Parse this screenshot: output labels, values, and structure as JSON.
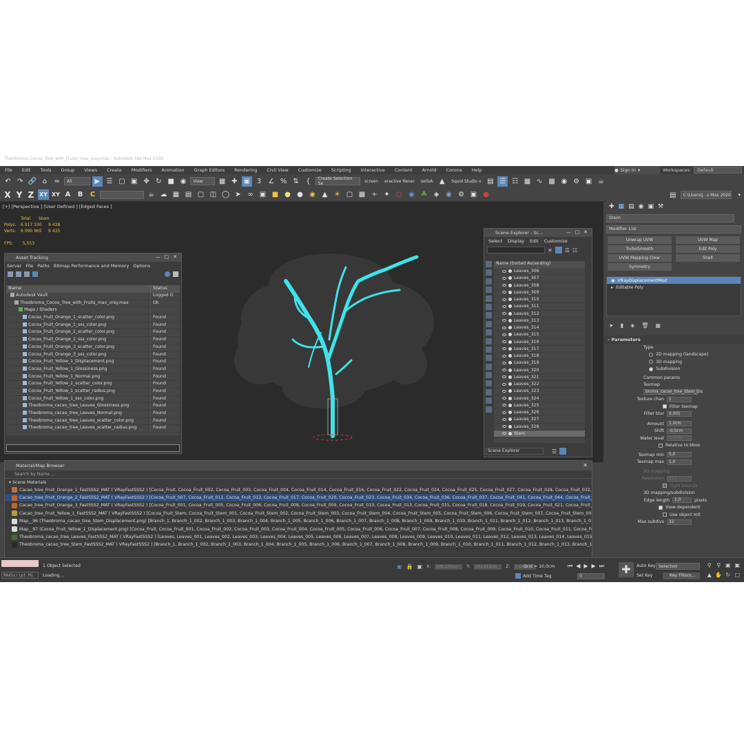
{
  "window": {
    "title": "Theobroma_Cocoa_Tree_with_Fruits_max_vray.max - Autodesk 3ds Max 2020"
  },
  "menubar": {
    "items": [
      "File",
      "Edit",
      "Tools",
      "Group",
      "Views",
      "Create",
      "Modifiers",
      "Animation",
      "Graph Editors",
      "Rendering",
      "Civil View",
      "Customize",
      "Scripting",
      "Interactive",
      "Content",
      "Arnold",
      "Corona",
      "Help"
    ]
  },
  "signin": {
    "label": "Sign In"
  },
  "workspaces": {
    "label": "Workspaces:",
    "value": "Default"
  },
  "toolbar": {
    "filter_value": "All",
    "view_value": "View",
    "selection_set": "Create Selection Se",
    "screen_label": "screen",
    "interactive_label": "eractive Rener",
    "sellsA_label": "sellsA",
    "squid_label": "Squid Studio v",
    "axis": [
      "X",
      "Y",
      "Z",
      "XY",
      "XY"
    ],
    "path": "C:\\Users\\J...s Max 2020"
  },
  "viewport": {
    "label": "[+] [Perspective ] [User Defined ] [Edged Faces ]",
    "stats": {
      "total_label": "Total",
      "stem_label": "Stem",
      "polys_label": "Polys:",
      "polys_total": "6 017 330",
      "polys_stem": "9 438",
      "verts_label": "Verts:",
      "verts_total": "6 090 965",
      "verts_stem": "9 435",
      "fps_label": "FPS:",
      "fps_value": "5,553"
    }
  },
  "asset_tracking": {
    "title": "Asset Tracking",
    "menu": [
      "Server",
      "File",
      "Paths",
      "Bitmap Performance and Memory",
      "Options"
    ],
    "columns": {
      "name": "Name",
      "status": "Status"
    },
    "rows": [
      {
        "name": "Autodesk Vault",
        "status": "Logged O",
        "indent": 1
      },
      {
        "name": "Theobroma_Cocoa_Tree_with_Fruits_max_vray.max",
        "status": "Ok",
        "indent": 2
      },
      {
        "name": "Maps / Shaders",
        "status": "",
        "indent": 3
      },
      {
        "name": "Cocoa_Fruit_Orange_1_scatter_color.png",
        "status": "Found",
        "indent": 4
      },
      {
        "name": "Cocoa_Fruit_Orange_1_sss_color.png",
        "status": "Found",
        "indent": 4
      },
      {
        "name": "Cocoa_Fruit_Orange_2_scatter_color.png",
        "status": "Found",
        "indent": 4
      },
      {
        "name": "Cocoa_Fruit_Orange_2_sss_color.png",
        "status": "Found",
        "indent": 4
      },
      {
        "name": "Cocoa_Fruit_Orange_3_scatter_color.png",
        "status": "Found",
        "indent": 4
      },
      {
        "name": "Cocoa_Fruit_Orange_3_sss_color.png",
        "status": "Found",
        "indent": 4
      },
      {
        "name": "Cocoa_Fruit_Yellow_1_Displacement.png",
        "status": "Found",
        "indent": 4
      },
      {
        "name": "Cocoa_Fruit_Yellow_1_Glossiness.png",
        "status": "Found",
        "indent": 4
      },
      {
        "name": "Cocoa_Fruit_Yellow_1_Normal.png",
        "status": "Found",
        "indent": 4
      },
      {
        "name": "Cocoa_Fruit_Yellow_1_scatter_color.png",
        "status": "Found",
        "indent": 4
      },
      {
        "name": "Cocoa_Fruit_Yellow_1_scatter_radius.png",
        "status": "Found",
        "indent": 4
      },
      {
        "name": "Cocoa_Fruit_Yellow_1_sss_color.png",
        "status": "Found",
        "indent": 4
      },
      {
        "name": "Theobroma_cacao_tree_Leaves_Glossiness.png",
        "status": "Found",
        "indent": 4
      },
      {
        "name": "Theobroma_cacao_tree_Leaves_Normal.png",
        "status": "Found",
        "indent": 4
      },
      {
        "name": "Theobroma_cacao_tree_Leaves_scatter_color.png",
        "status": "Found",
        "indent": 4
      },
      {
        "name": "Theobroma_cacao_tree_Leaves_scatter_radius.png",
        "status": "Found",
        "indent": 4
      }
    ]
  },
  "scene_explorer": {
    "title": "Scene Explorer - Sc...",
    "menu": [
      "Select",
      "Display",
      "Edit",
      "Customize"
    ],
    "column": "Name (Sorted Ascending)",
    "items": [
      "Leaves_306",
      "Leaves_307",
      "Leaves_308",
      "Leaves_309",
      "Leaves_310",
      "Leaves_311",
      "Leaves_312",
      "Leaves_313",
      "Leaves_314",
      "Leaves_315",
      "Leaves_316",
      "Leaves_317",
      "Leaves_318",
      "Leaves_319",
      "Leaves_320",
      "Leaves_321",
      "Leaves_322",
      "Leaves_323",
      "Leaves_324",
      "Leaves_325",
      "Leaves_326",
      "Leaves_327",
      "Leaves_328",
      "Stem"
    ],
    "footer": "Scene Explorer"
  },
  "material_browser": {
    "title": "Material/Map Browser",
    "search_placeholder": "Search by Name ...",
    "section": "Scene Materials",
    "rows": [
      {
        "text": "Cacao_tree_Fruit_Orange_1_FastSSS2_MAT  ( VRayFastSSS2 )  [Cocoa_Fruit, Cocoa_Fruit_002, Cocoa_Fruit_003, Cocoa_Fruit_004, Cocoa_Fruit_014, Cocoa_Fruit_016, Cocoa_Fruit_022, Cocoa_Fruit_024, Cocoa_Fruit_025, Cocoa_Fruit_027, Cocoa_Fruit_028, Cocoa_Fruit_032, Cocoa_Fru...",
        "color": "#c0703a"
      },
      {
        "text": "Cacao_tree_Fruit_Orange_2_FastSSS2_MAT  ( VRayFastSSS2 )  [Cocoa_Fruit_007, Cocoa_Fruit_011, Cocoa_Fruit_012, Cocoa_Fruit_017, Cocoa_Fruit_020, Cocoa_Fruit_023, Cocoa_Fruit_034, Cocoa_Fruit_036, Cocoa_Fruit_037, Cocoa_Fruit_041, Cocoa_Fruit_044, Cocoa_Fruit_045, Coco...",
        "color": "#c8602a"
      },
      {
        "text": "Cacao_tree_Fruit_Orange_3_FastSSS2_MAT  ( VRayFastSSS2 )  [Cocoa_Fruit_001, Cocoa_Fruit_005, Cocoa_Fruit_006, Cocoa_Fruit_008, Cocoa_Fruit_009, Cocoa_Fruit_010, Cocoa_Fruit_013, Cocoa_Fruit_015, Cocoa_Fruit_018, Cocoa_Fruit_019, Cocoa_Fruit_021, Cocoa_Fruit_026, Coco...",
        "color": "#b8682c"
      },
      {
        "text": "Cacao_tree_Fruit_Yellow_1_FastSSS2_MAT  ( VRayFastSSS2 )  [Cocoa_Fruit_Stem, Cocoa_Fruit_Stem_001, Cocoa_Fruit_Stem_002, Cocoa_Fruit_Stem_003, Cocoa_Fruit_Stem_004, Cocoa_Fruit_Stem_005, Cocoa_Fruit_Stem_006, Cocoa_Fruit_Stem_007, Cocoa_Fruit_Stem_008, Cocoa_F...",
        "color": "#b0a040"
      },
      {
        "text": "Map__96 (Theobroma_cacao_tree_Stem_Displacement.png)  [Branch_1, Branch_1_002, Branch_1_003, Branch_1_004, Branch_1_005, Branch_1_006, Branch_1_007, Branch_1_008, Branch_1_009, Branch_1_010, Branch_1_011, Branch_1_012, Branch_1_013, Branch_1_014, Branch...",
        "color": "#d8d8d8"
      },
      {
        "text": "Map__97 (Cocoa_Fruit_Yellow_1_Displacement.png)  [Cocoa_Fruit, Cocoa_Fruit_001, Cocoa_Fruit_002, Cocoa_Fruit_003, Cocoa_Fruit_004, Cocoa_Fruit_005, Cocoa_Fruit_006, Cocoa_Fruit_007, Cocoa_Fruit_008, Cocoa_Fruit_009, Cocoa_Fruit_010, Cocoa_Fruit_011, Cocoa_Fruit_012, Co...",
        "color": "#d8d8d8"
      },
      {
        "text": "Theobroma_cacao_tree_Leaves_FastSSS2_MAT  ( VRayFastSSS2 )  [Leaves, Leaves_001, Leaves_002, Leaves_003, Leaves_004, Leaves_005, Leaves_006, Leaves_007, Leaves_008, Leaves_009, Leaves_010, Leaves_011, Leaves_012, Leaves_013, Leaves_014, Leaves_015, Leaves_016, L...",
        "color": "#4a6a30"
      },
      {
        "text": "Theobroma_cacao_tree_Stem_FastSSS2_MAT  ( VRayFastSSS2 )  [Branch_1, Branch_1_002, Branch_1_003, Branch_1_004, Branch_1_005, Branch_1_006, Branch_1_007, Branch_1_008, Branch_1_009, Branch_1_010, Branch_1_011, Branch_1_012, Branch_1_013, Branch_1_014, Branch...",
        "color": "#2a2a2a"
      }
    ]
  },
  "command_panel": {
    "object_name": "Stem",
    "modifier_list": "Modifier List",
    "mod_buttons": [
      "Unwrap UVW",
      "UVW Map",
      "TurboSmooth",
      "Edit Poly",
      "UVW Mapping Clear",
      "Shell",
      "Symmetry"
    ],
    "stack": [
      "VRayDisplacementMod",
      "Editable Poly"
    ],
    "params_title": "Parameters",
    "type_label": "Type",
    "type_options": [
      "2D mapping (landscape)",
      "3D mapping",
      "Subdivision"
    ],
    "common_params": "Common params",
    "texmap_label": "Texmap",
    "texmap_value": "broma_cacao_tree_Stem_Dis",
    "texture_chan_label": "Texture chan",
    "texture_chan_value": "1",
    "filter_texmap": "Filter texmap",
    "filter_blur_label": "Filter blur",
    "filter_blur_value": "0,001",
    "amount_label": "Amount",
    "amount_value": "1,0cm",
    "shift_label": "Shift",
    "shift_value": "-0,5cm",
    "water_level_label": "Water level",
    "water_level_value": "0,0cm",
    "relative_bbox": "Relative to bbox",
    "texmap_min_label": "Texmap min",
    "texmap_min_value": "0,0",
    "texmap_max_label": "Texmap max",
    "texmap_max_value": "1,0",
    "mapping_2d": "2D mapping",
    "resolution_label": "Resolution",
    "resolution_value": "512",
    "tight_bounds": "Tight bounds",
    "mapping_3d": "3D mapping/subdivision",
    "edge_length_label": "Edge length",
    "edge_length_value": "1,0",
    "edge_length_unit": "pixels",
    "view_dependent": "View-dependent",
    "use_object_mtl": "Use object mtl",
    "max_subdivs_label": "Max subdivs",
    "max_subdivs_value": "32"
  },
  "statusbar": {
    "maxscript": "MAXScript Mi",
    "selected_text": "1 Object Selected",
    "loading_text": "Loading...",
    "x_label": "X:",
    "x_value": "205,229cm",
    "y_label": "Y:",
    "y_value": "251,013cm",
    "z_label": "Z:",
    "z_value": "0,0cm",
    "grid": "Grid = 10,0cm",
    "add_time_tag": "Add Time Tag",
    "frame": "0",
    "auto_key": "Auto Key",
    "set_key": "Set Key",
    "selected_value": "Selected",
    "key_filters": "Key Filters..."
  }
}
